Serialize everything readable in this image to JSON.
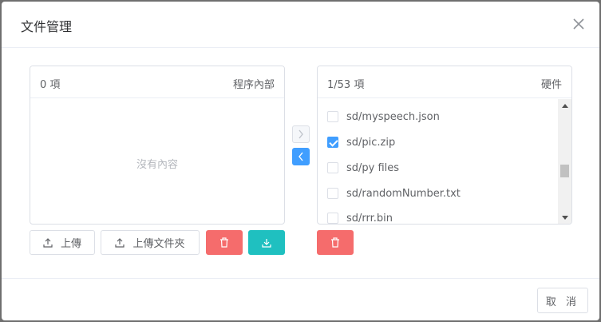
{
  "dialog": {
    "title": "文件管理",
    "cancel_label": "取 消"
  },
  "left_panel": {
    "count": "0 項",
    "title": "程序內部",
    "empty_text": "沒有內容"
  },
  "right_panel": {
    "count": "1/53 項",
    "title": "硬件",
    "items": [
      {
        "label": "sd/myspeech.json",
        "checked": false
      },
      {
        "label": "sd/pic.zip",
        "checked": true
      },
      {
        "label": "sd/py files",
        "checked": false
      },
      {
        "label": "sd/randomNumber.txt",
        "checked": false
      },
      {
        "label": "sd/rrr.bin",
        "checked": false
      }
    ]
  },
  "actions": {
    "upload_label": "上傳",
    "upload_folder_label": "上傳文件夾"
  },
  "icons": {
    "close": "close-icon",
    "upload": "upload-icon",
    "trash": "trash-icon",
    "download": "download-icon",
    "chevron_right": "chevron-right-icon",
    "chevron_left": "chevron-left-icon"
  },
  "colors": {
    "primary": "#409eff",
    "danger": "#f56c6c",
    "teal": "#1fc0c0"
  }
}
